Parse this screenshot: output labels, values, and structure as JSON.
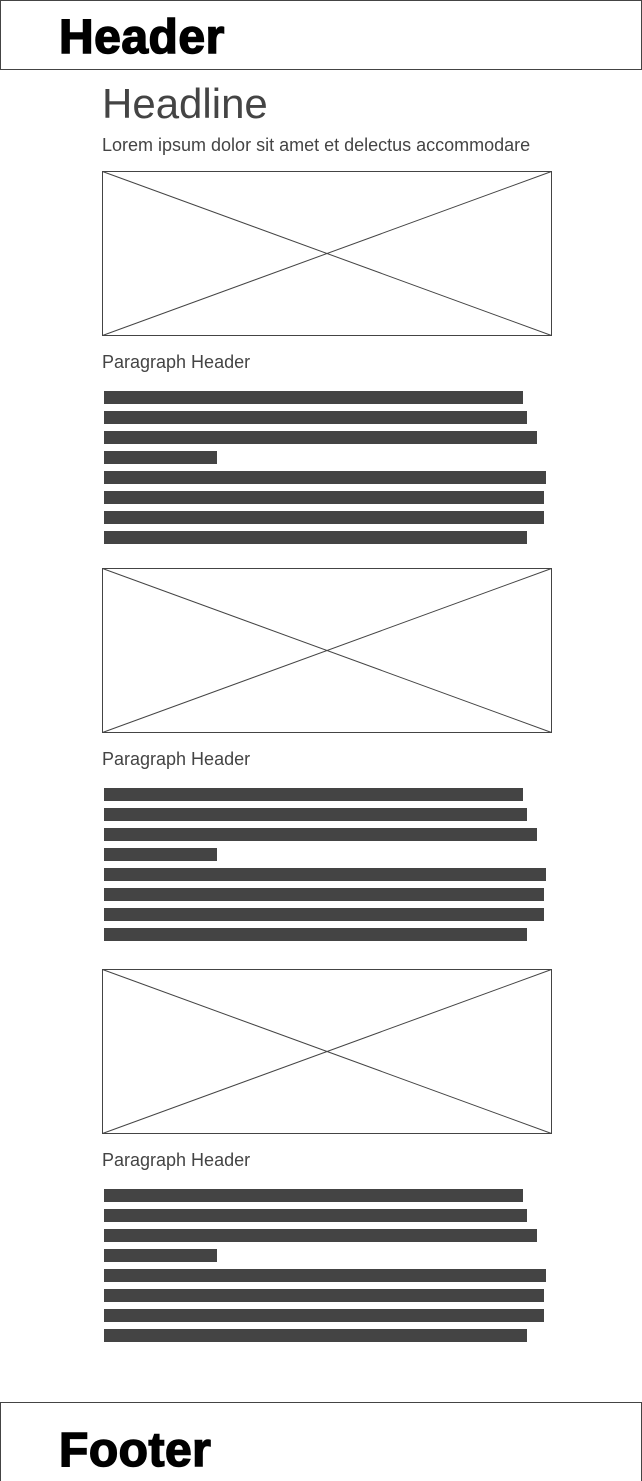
{
  "header": {
    "title": "Header"
  },
  "main": {
    "headline": "Headline",
    "subline": "Lorem ipsum dolor sit amet et delectus accommodare",
    "sections": [
      {
        "paragraph_header": "Paragraph Header",
        "image_placeholder": "image-placeholder-icon"
      },
      {
        "paragraph_header": "Paragraph Header",
        "image_placeholder": "image-placeholder-icon"
      },
      {
        "paragraph_header": "Paragraph Header",
        "image_placeholder": "image-placeholder-icon"
      }
    ]
  },
  "footer": {
    "title": "Footer"
  },
  "colors": {
    "text": "#444444",
    "frame_title": "#000000",
    "background": "#ffffff"
  }
}
